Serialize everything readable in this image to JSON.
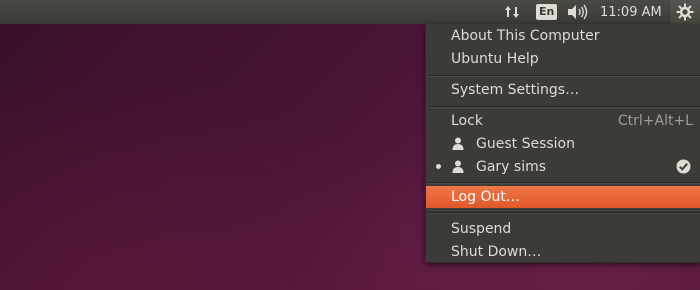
{
  "panel": {
    "keyboard_layout": "En",
    "clock": "11:09 AM",
    "icons": [
      "network-transfer-icon",
      "keyboard-layout-icon",
      "volume-icon",
      "gear-icon"
    ]
  },
  "menu": {
    "about": "About This Computer",
    "help": "Ubuntu Help",
    "settings": "System Settings…",
    "lock": "Lock",
    "lock_shortcut": "Ctrl+Alt+L",
    "guest": "Guest Session",
    "user": "Gary sims",
    "logout": "Log Out…",
    "suspend": "Suspend",
    "shutdown": "Shut Down…"
  },
  "colors": {
    "panel_bg": "#3c3b37",
    "menu_bg": "#3c3b37",
    "highlight": "#e9642f",
    "text": "#dfdbd2"
  }
}
